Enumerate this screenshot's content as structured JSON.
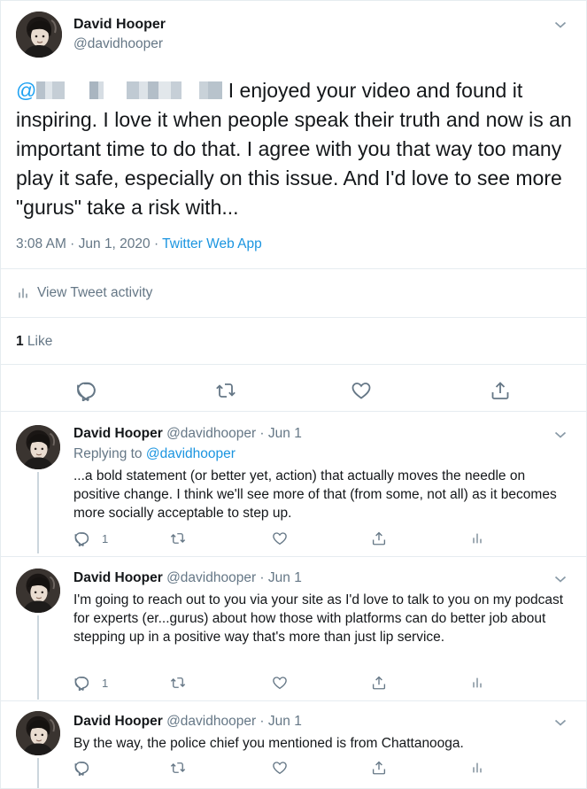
{
  "main": {
    "name": "David Hooper",
    "handle": "@davidhooper",
    "mention_at": "@",
    "text": "I enjoyed your video and found it inspiring. I love it when people speak their truth and now is an important time to do that. I agree with you that way too many play it safe, especially on this issue. And I'd love to see more \"gurus\" take a risk with...",
    "time": "3:08 AM · Jun 1, 2020 · ",
    "app": "Twitter Web App",
    "activity": "View Tweet activity",
    "like_count": "1",
    "like_label": " Like"
  },
  "replies": [
    {
      "name": "David Hooper",
      "handle": " @davidhooper · Jun 1",
      "replying_label": "Replying to ",
      "replying_to": "@davidhooper",
      "text": "...a bold statement (or better yet, action) that actually moves the needle on positive change. I think we'll see more of that (from some, not all) as it becomes more socially acceptable to step up.",
      "reply_count": "1"
    },
    {
      "name": "David Hooper",
      "handle": " @davidhooper · Jun 1",
      "text": "I'm going to reach out to you via your site as I'd love to talk to you on my podcast for experts (er...gurus) about how those with platforms can do better job about stepping up in a positive way that's more than just lip service.",
      "reply_count": "1"
    },
    {
      "name": "David Hooper",
      "handle": " @davidhooper · Jun 1",
      "text": "By the way, the police chief you mentioned is from Chattanooga."
    }
  ],
  "icons": {
    "reply": "reply-icon",
    "retweet": "retweet-icon",
    "like": "heart-icon",
    "share": "share-icon",
    "analytics": "analytics-icon",
    "more": "chevron-down-icon"
  },
  "colors": {
    "link": "#1b95e0",
    "muted": "#657786",
    "text": "#14171a",
    "border": "#e6ecf0"
  }
}
